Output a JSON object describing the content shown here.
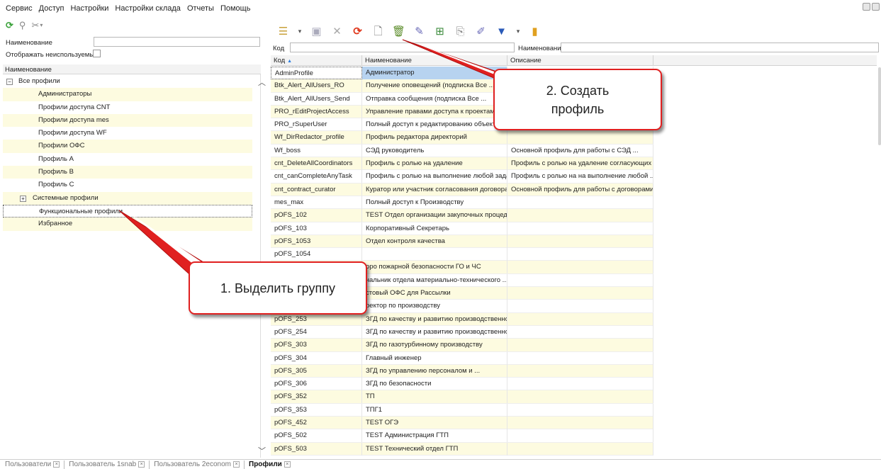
{
  "menu": {
    "items": [
      "Сервис",
      "Доступ",
      "Настройки",
      "Настройки склада",
      "Отчеты",
      "Помощь"
    ]
  },
  "left_filter": {
    "name_label": "Наименование",
    "name_value": "",
    "show_unused_label": "Отображать неиспользуемые",
    "show_unused_checked": false
  },
  "tree": {
    "column_header": "Наименование",
    "rows": [
      {
        "label": "Все профили",
        "expander": "minus",
        "highlight": false,
        "selected": false
      },
      {
        "label": "Администраторы",
        "expander": "",
        "highlight": true,
        "selected": false
      },
      {
        "label": "Профили доступа CNT",
        "expander": "",
        "highlight": false,
        "selected": false
      },
      {
        "label": "Профили доступа mes",
        "expander": "",
        "highlight": true,
        "selected": false
      },
      {
        "label": "Профили доступа WF",
        "expander": "",
        "highlight": false,
        "selected": false
      },
      {
        "label": "Профили ОФС",
        "expander": "",
        "highlight": true,
        "selected": false
      },
      {
        "label": "Профиль A",
        "expander": "",
        "highlight": false,
        "selected": false
      },
      {
        "label": "Профиль B",
        "expander": "",
        "highlight": true,
        "selected": false
      },
      {
        "label": "Профиль C",
        "expander": "",
        "highlight": false,
        "selected": false
      },
      {
        "label": "Системные профили",
        "expander": "plus",
        "highlight": true,
        "selected": false
      },
      {
        "label": "Функциональные профили",
        "expander": "",
        "highlight": false,
        "selected": true
      },
      {
        "label": "Избранное",
        "expander": "",
        "highlight": true,
        "selected": false
      }
    ]
  },
  "toolbar_icons": {
    "left": [
      "refresh-icon",
      "search-icon",
      "tools-icon",
      "dropdown-arrow-icon"
    ],
    "right": [
      "hierarchy-icon",
      "dropdown-arrow-icon",
      "save-icon",
      "delete-icon",
      "refresh-icon",
      "create-icon",
      "trash-icon",
      "edit-icon",
      "table-icon",
      "copy-icon",
      "edit-list-icon",
      "filter-icon",
      "dropdown-arrow-icon",
      "exit-icon"
    ]
  },
  "right_filter": {
    "code_label": "Код",
    "code_value": "",
    "name_label": "Наименование",
    "name_value": ""
  },
  "grid": {
    "columns": [
      "Код",
      "Наименование",
      "Описание"
    ],
    "sort_indicator": "▲",
    "rows": [
      {
        "code": "AdminProfile",
        "name": "Администратор",
        "desc": ""
      },
      {
        "code": "Btk_Alert_AllUsers_RO",
        "name": "Получение оповещений (подписка Все ...",
        "desc": ""
      },
      {
        "code": "Btk_Alert_AllUsers_Send",
        "name": "Отправка сообщения (подписка Все ...",
        "desc": ""
      },
      {
        "code": "PRO_rEditProjectAccess",
        "name": "Управление правами доступа к проектам",
        "desc": ""
      },
      {
        "code": "PRO_rSuperUser",
        "name": "Полный доступ к редактированию объектов",
        "desc": ""
      },
      {
        "code": "Wf_DirRedactor_profile",
        "name": "Профиль редактора директорий",
        "desc": ""
      },
      {
        "code": "Wf_boss",
        "name": "СЭД руководитель",
        "desc": "Основной профиль для работы с СЭД ..."
      },
      {
        "code": "cnt_DeleteAllCoordinators",
        "name": "Профиль с ролью на удаление",
        "desc": "Профиль с ролью на удаление согласующих в ..."
      },
      {
        "code": "cnt_canCompleteAnyTask",
        "name": "Профиль с ролью на выполнение любой задачи",
        "desc": "Профиль с ролью на на выполнение любой ..."
      },
      {
        "code": "cnt_contract_curator",
        "name": "Куратор или участник согласования договора",
        "desc": "Основной профиль для работы с договорами"
      },
      {
        "code": "mes_max",
        "name": "Полный доступ к Производству",
        "desc": ""
      },
      {
        "code": "pOFS_102",
        "name": "TEST Отдел организации закупочных процедур",
        "desc": ""
      },
      {
        "code": "pOFS_103",
        "name": "Корпоративный Секретарь",
        "desc": ""
      },
      {
        "code": "pOFS_1053",
        "name": "Отдел контроля качества",
        "desc": ""
      },
      {
        "code": "pOFS_1054",
        "name": "",
        "desc": ""
      },
      {
        "code": "",
        "name": "оро пожарной безопасности ГО и ЧС",
        "desc": ""
      },
      {
        "code": "",
        "name": "чальник отдела материально-технического ...",
        "desc": ""
      },
      {
        "code": "",
        "name": "стовый ОФС для Рассылки",
        "desc": ""
      },
      {
        "code": "",
        "name": "ректор по производству",
        "desc": ""
      },
      {
        "code": "pOFS_253",
        "name": "ЗГД по качеству и развитию производственно...",
        "desc": ""
      },
      {
        "code": "pOFS_254",
        "name": "ЗГД по качеству и развитию производственно...",
        "desc": ""
      },
      {
        "code": "pOFS_303",
        "name": "ЗГД по газотурбинному производству",
        "desc": ""
      },
      {
        "code": "pOFS_304",
        "name": "Главный инженер",
        "desc": ""
      },
      {
        "code": "pOFS_305",
        "name": "ЗГД по управлению персоналом и ...",
        "desc": ""
      },
      {
        "code": "pOFS_306",
        "name": "ЗГД по безопасности",
        "desc": ""
      },
      {
        "code": "pOFS_352",
        "name": "ТП",
        "desc": ""
      },
      {
        "code": "pOFS_353",
        "name": "ТПГ1",
        "desc": ""
      },
      {
        "code": "pOFS_452",
        "name": "TEST ОГЭ",
        "desc": ""
      },
      {
        "code": "pOFS_502",
        "name": "TEST Администрация ГТП",
        "desc": ""
      },
      {
        "code": "pOFS_503",
        "name": "TEST Технический отдел ГТП",
        "desc": ""
      }
    ]
  },
  "callouts": {
    "select_group": "1. Выделить группу",
    "create_profile_line1": "2. Создать",
    "create_profile_line2": "профиль"
  },
  "tabs": [
    {
      "label": "Пользователи",
      "active": false
    },
    {
      "label": "Пользователь 1snab",
      "active": false
    },
    {
      "label": "Пользователь 2econom",
      "active": false
    },
    {
      "label": "Профили",
      "active": true
    }
  ],
  "colors": {
    "row_highlight": "#fdfbe0",
    "selection_blue": "#b7d3f0",
    "callout_red": "#e02020"
  }
}
